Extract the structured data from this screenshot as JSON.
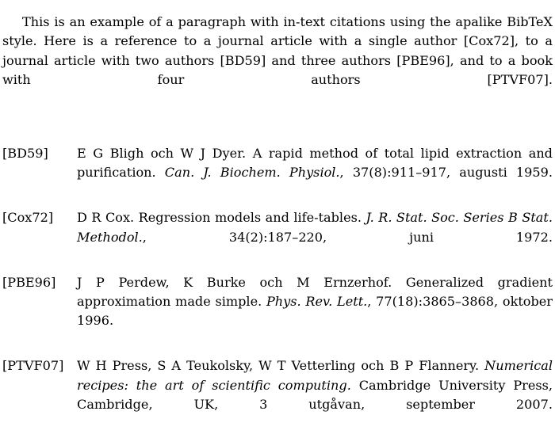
{
  "document": {
    "intro_paragraph": "This is an example of a paragraph with in-text citations using the apalike BibTeX style. Here is a reference to a journal article with a single author [Cox72], to a journal article with two authors [BD59] and three authors [PBE96], and to a book with four authors [PTVF07].",
    "bibliography": {
      "entries": [
        {
          "label": "[BD59]",
          "authors": "E G Bligh och W J Dyer.",
          "title": "A rapid method of total lipid extraction and purification.",
          "journal": "Can. J. Biochem. Physiol.",
          "details": ", 37(8):911–917, augusti 1959."
        },
        {
          "label": "[Cox72]",
          "authors": "D R Cox.",
          "title": "Regression models and life-tables.",
          "journal": "J. R. Stat. Soc. Series B Stat. Methodol.",
          "details": ", 34(2):187–220, juni 1972."
        },
        {
          "label": "[PBE96]",
          "authors": "J P Perdew, K Burke och M Ernzerhof.",
          "title": "Generalized gradient approximation made simple.",
          "journal": "Phys. Rev. Lett.",
          "details": ", 77(18):3865–3868, oktober 1996."
        },
        {
          "label": "[PTVF07]",
          "authors": "W H Press, S A Teukolsky, W T Vetterling och B P Flannery.",
          "title": "Numerical recipes: the art of scientific computing.",
          "journal": "",
          "details": "Cambridge University Press, Cambridge, UK, 3 utgåvan, september 2007."
        }
      ]
    }
  },
  "colors": {
    "page_background": "#ffffff",
    "text": "#000000"
  }
}
